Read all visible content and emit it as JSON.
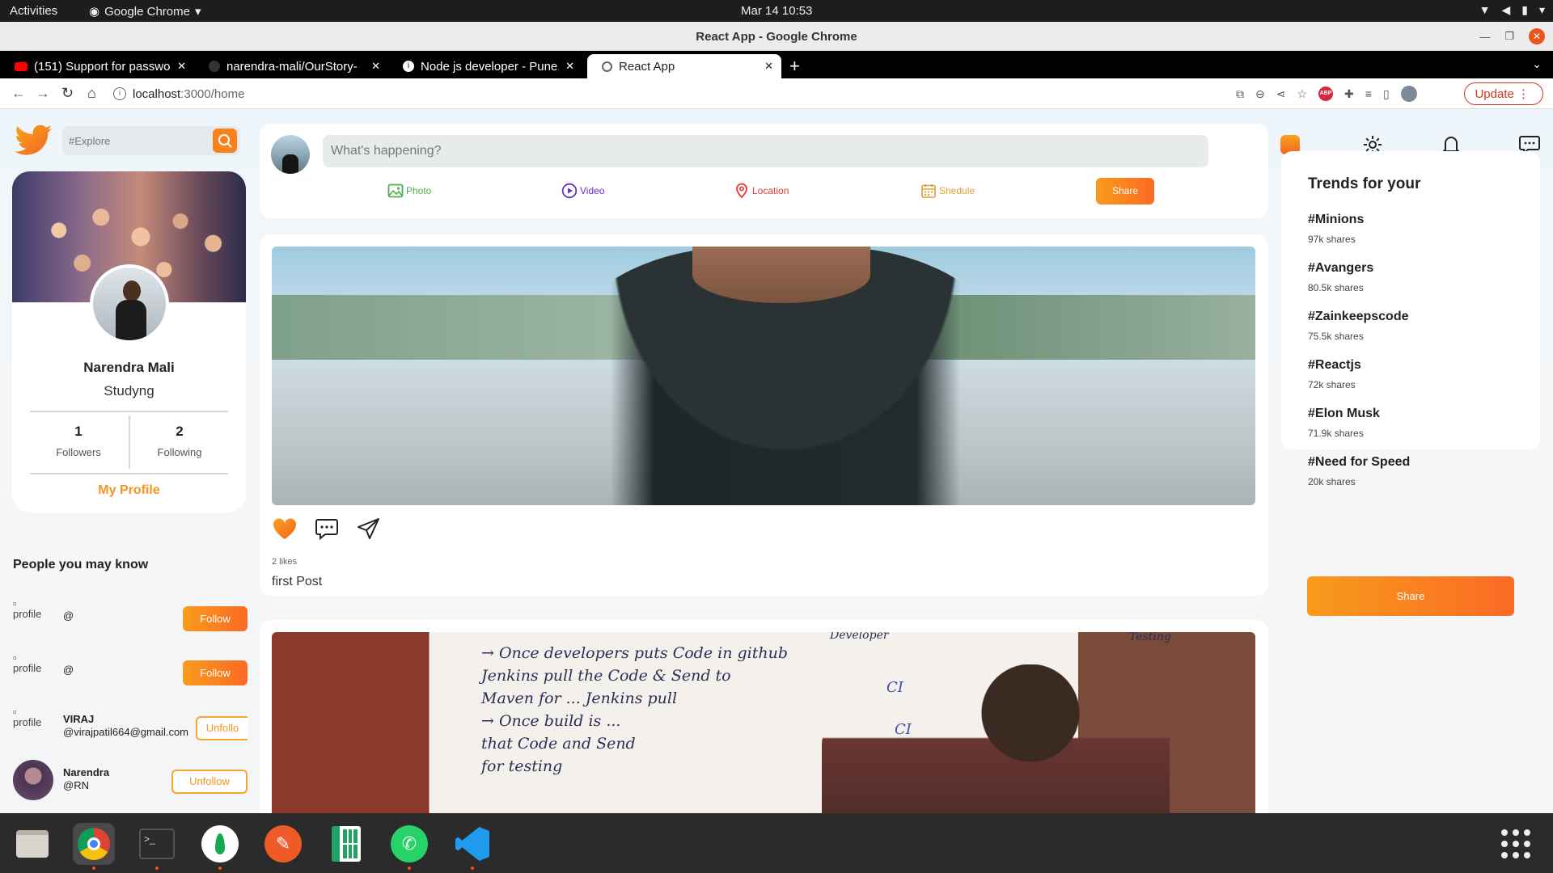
{
  "system": {
    "activities": "Activities",
    "app_name": "Google Chrome",
    "clock": "Mar 14  10:53"
  },
  "window": {
    "title": "React App - Google Chrome"
  },
  "tabs": [
    {
      "label": "(151) Support for passwo"
    },
    {
      "label": "narendra-mali/OurStory-"
    },
    {
      "label": "Node js developer - Pune,"
    },
    {
      "label": "React App"
    }
  ],
  "address": {
    "host": "localhost",
    "path": ":3000/home",
    "update_label": "Update"
  },
  "search": {
    "placeholder": "#Explore"
  },
  "profile": {
    "name": "Narendra Mali",
    "status": "Studyng",
    "followers_count": "1",
    "followers_label": "Followers",
    "following_count": "2",
    "following_label": "Following",
    "my_profile_label": "My Profile"
  },
  "people": {
    "heading": "People you may know",
    "items": [
      {
        "img_alt": "profile",
        "name": "",
        "handle": "@",
        "action": "Follow"
      },
      {
        "img_alt": "profile",
        "name": "",
        "handle": "@",
        "action": "Follow"
      },
      {
        "img_alt": "profile",
        "name": "VIRAJ",
        "handle": "@virajpatil664@gmail.com",
        "action": "Unfollo"
      },
      {
        "img_alt": "",
        "name": "Narendra",
        "handle": "@RN",
        "action": "Unfollow"
      }
    ]
  },
  "composer": {
    "placeholder": "What's happening?",
    "options": [
      {
        "label": "Photo",
        "color": "#4caf50"
      },
      {
        "label": "Video",
        "color": "#6c2bd9"
      },
      {
        "label": "Location",
        "color": "#e53935"
      },
      {
        "label": "Shedule",
        "color": "#e0a030"
      }
    ],
    "share_label": "Share"
  },
  "posts": [
    {
      "likes": "2 likes",
      "caption": "first Post"
    }
  ],
  "whiteboard": {
    "lines": [
      "→ Once developers puts Code in github",
      "Jenkins pull the Code & Send to",
      "Maven for ...  Jenkins pull",
      "→ Once build is ...",
      "that Code and Send",
      "for testing"
    ],
    "side_labels": [
      "Developer",
      "Testing",
      "CI",
      "CI"
    ]
  },
  "trends": {
    "title": "Trends for your",
    "items": [
      {
        "tag": "#Minions",
        "shares": "97k shares"
      },
      {
        "tag": "#Avangers",
        "shares": "80.5k shares"
      },
      {
        "tag": "#Zainkeepscode",
        "shares": "75.5k shares"
      },
      {
        "tag": "#Reactjs",
        "shares": "72k shares"
      },
      {
        "tag": "#Elon Musk",
        "shares": "71.9k shares"
      },
      {
        "tag": "#Need for Speed",
        "shares": "20k shares"
      }
    ],
    "share_label": "Share"
  },
  "colors": {
    "accent": "#f7931e",
    "accent_gradient_end": "#fb6a24"
  }
}
